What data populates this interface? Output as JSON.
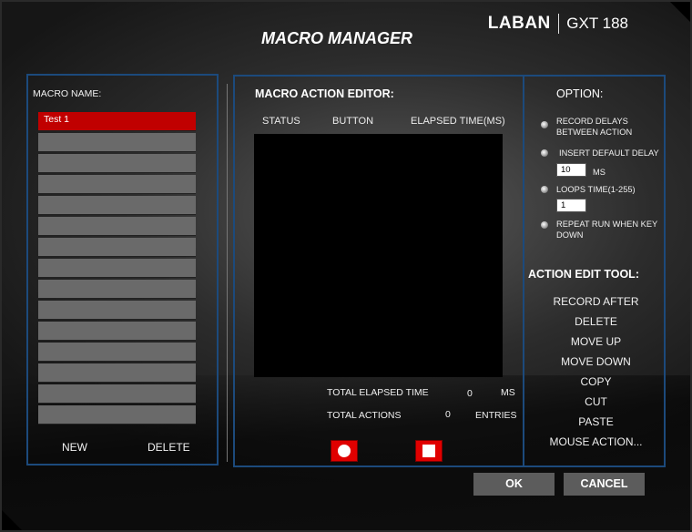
{
  "window": {
    "title": "MACRO MANAGER"
  },
  "brand": {
    "name": "LABAN",
    "model": "GXT 188"
  },
  "left_panel": {
    "label": "MACRO NAME:",
    "macros": [
      "Test 1",
      "",
      "",
      "",
      "",
      "",
      "",
      "",
      "",
      "",
      "",
      "",
      "",
      "",
      ""
    ],
    "new_label": "NEW",
    "delete_label": "DELETE"
  },
  "editor": {
    "title": "MACRO ACTION EDITOR:",
    "columns": [
      "STATUS",
      "BUTTON",
      "ELAPSED TIME(MS)"
    ],
    "total_elapsed_label": "TOTAL ELAPSED TIME",
    "total_elapsed_value": "0",
    "total_elapsed_unit": "MS",
    "total_actions_label": "TOTAL ACTIONS",
    "total_actions_value": "0",
    "total_actions_unit": "ENTRIES"
  },
  "options": {
    "title": "OPTION:",
    "record_delays": "RECORD DELAYS BETWEEN ACTION",
    "insert_default_delay": "INSERT DEFAULT DELAY",
    "delay_value": "10",
    "delay_unit": "MS",
    "loops_time": "LOOPS TIME(1-255)",
    "loops_value": "1",
    "repeat_run": "REPEAT RUN WHEN KEY DOWN"
  },
  "tools": {
    "title": "ACTION EDIT TOOL:",
    "items": [
      "RECORD AFTER",
      "DELETE",
      "MOVE UP",
      "MOVE DOWN",
      "COPY",
      "CUT",
      "PASTE",
      "MOUSE ACTION..."
    ]
  },
  "dialog": {
    "ok": "OK",
    "cancel": "CANCEL"
  },
  "colors": {
    "accent_red": "#e00000",
    "panel_border": "#1c4a7c",
    "selected_row": "#c00000"
  },
  "icons": {
    "record": "record-icon",
    "stop": "stop-icon"
  }
}
